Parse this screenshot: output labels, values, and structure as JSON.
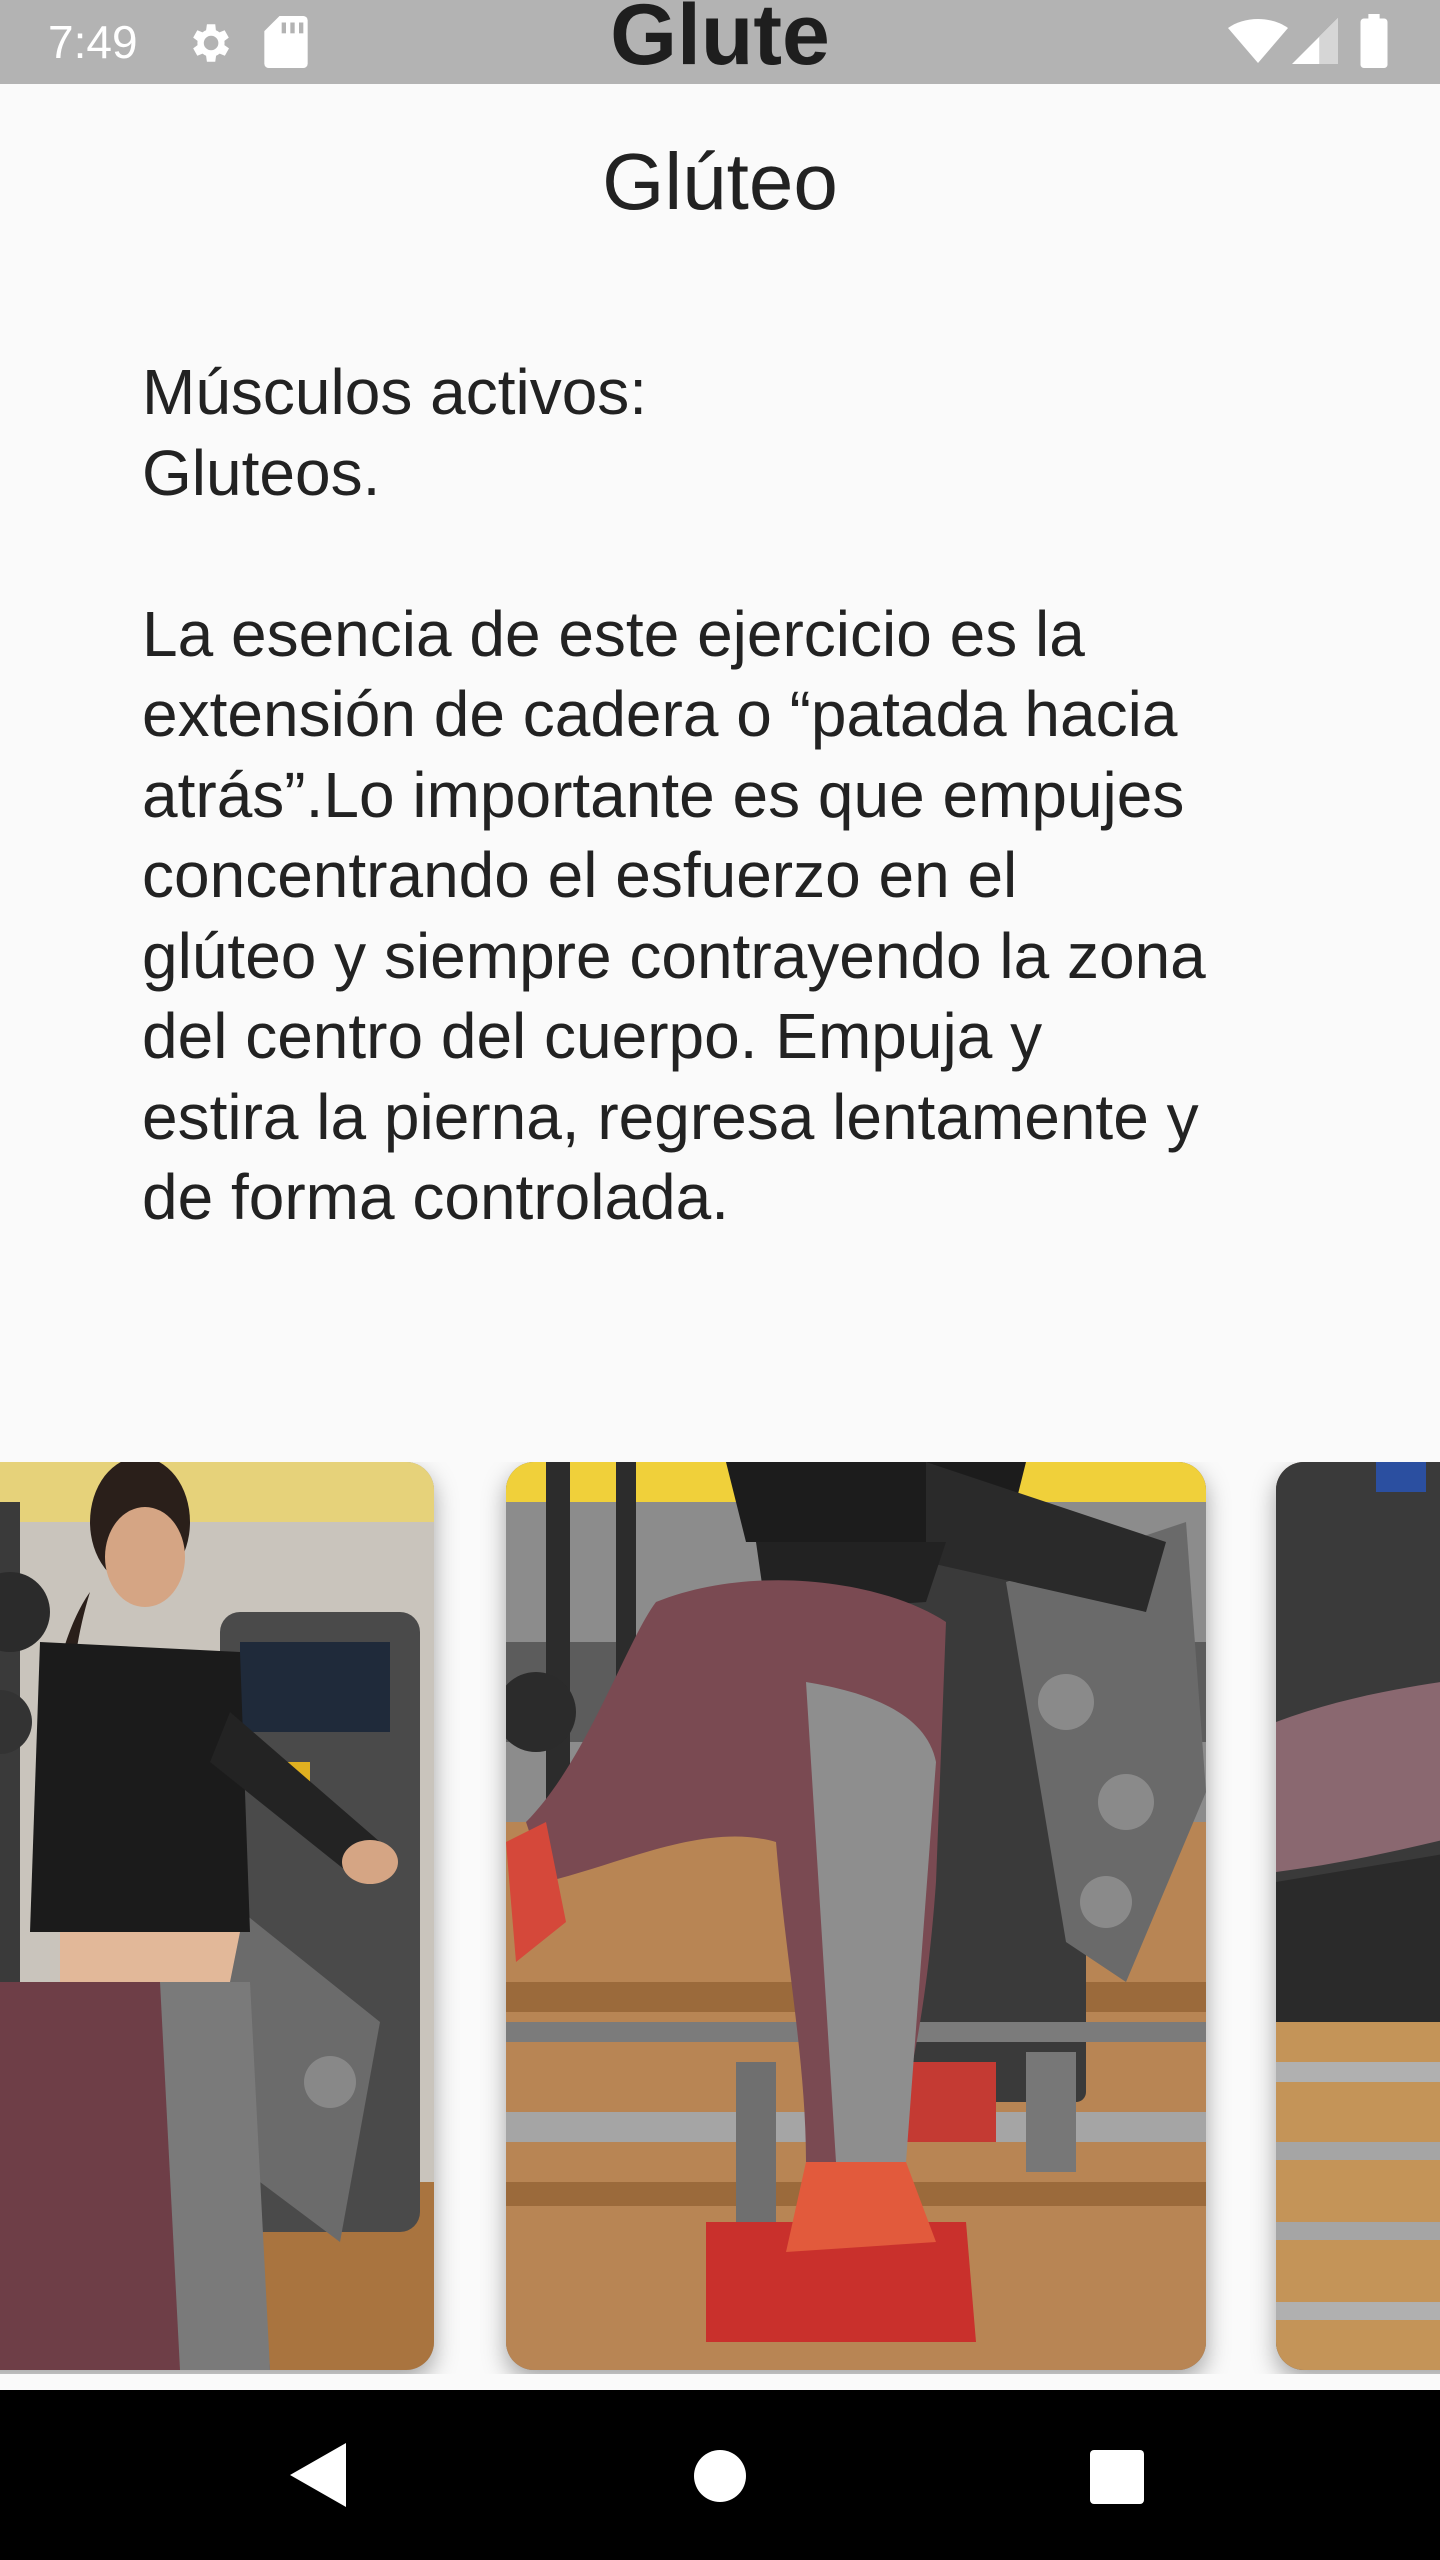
{
  "status_bar": {
    "time": "7:49",
    "icons": [
      "gear-icon",
      "sd-card-icon",
      "wifi-icon",
      "cell-signal-icon",
      "battery-icon"
    ],
    "overlay_title": "Glute"
  },
  "page": {
    "heading": "Glúteo",
    "description": "Músculos activos:\nGluteos.\n\nLa esencia de este ejercicio es la\nextensión de cadera o “patada hacia\natrás”.Lo importante es que empujes\nconcentrando el esfuerzo en el\nglúteo y siempre contrayendo la zona\ndel centro del cuerpo. Empuja y\nestira la pierna, regresa lentamente y\nde forma controlada."
  },
  "carousel": {
    "photos": [
      "exercise-photo-1",
      "exercise-photo-2",
      "exercise-photo-3"
    ]
  },
  "nav_bar": {
    "buttons": [
      "back-icon",
      "home-icon",
      "recents-icon"
    ]
  },
  "colors": {
    "status_bar_bg": "#b3b3b3",
    "page_bg": "#fafafa",
    "nav_bar_bg": "#000000",
    "text": "#222222"
  }
}
